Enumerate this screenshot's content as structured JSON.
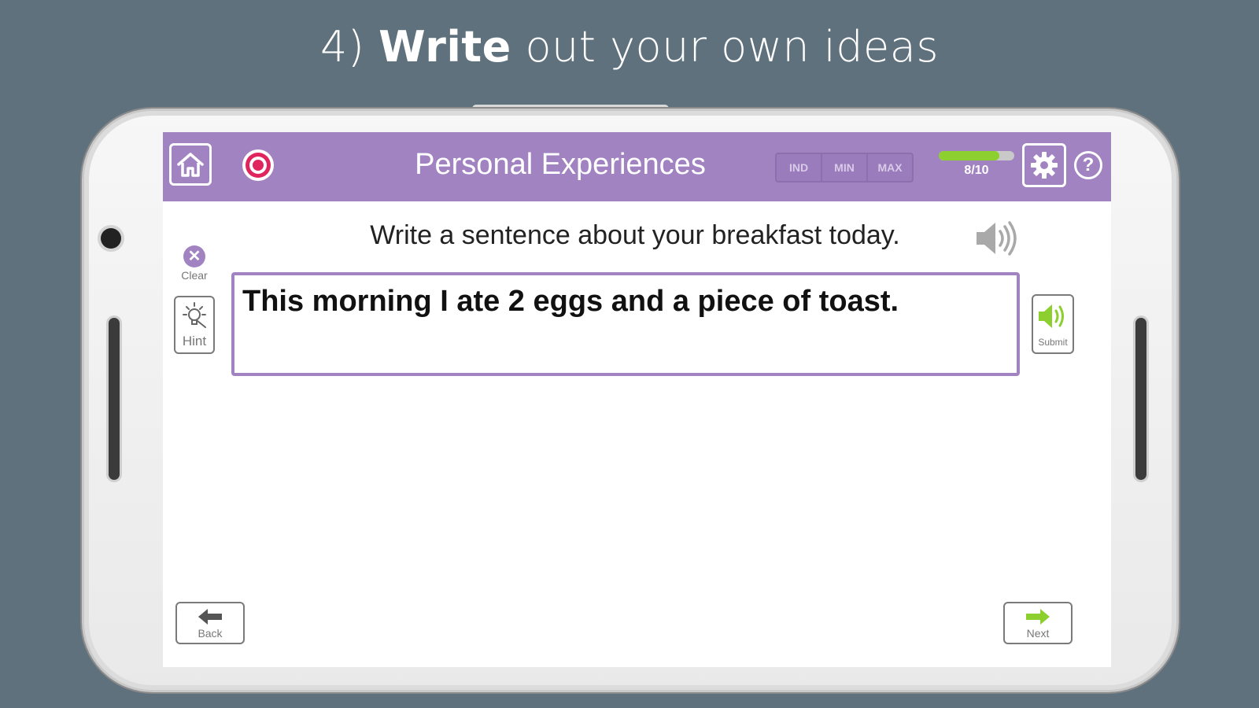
{
  "headline": {
    "number": "4)",
    "bold": "Write",
    "rest": "out your own ideas"
  },
  "app": {
    "title": "Personal Experiences",
    "modes": [
      "IND",
      "MIN",
      "MAX"
    ],
    "progress": {
      "text": "8/10",
      "current": 8,
      "total": 10
    },
    "help_label": "?"
  },
  "exercise": {
    "prompt": "Write a sentence about your breakfast today.",
    "answer": "This morning I ate 2 eggs and a piece of toast."
  },
  "buttons": {
    "clear": "Clear",
    "hint": "Hint",
    "submit": "Submit",
    "back": "Back",
    "next": "Next"
  },
  "icons": {
    "home": "home-icon",
    "record": "record-icon",
    "settings": "gear-icon",
    "help": "help-icon",
    "speaker": "speaker-icon",
    "clear": "clear-x-icon",
    "hint": "lightbulb-icon",
    "back": "arrow-left-icon",
    "next": "arrow-right-icon"
  },
  "colors": {
    "background": "#5f717d",
    "topbar": "#a283c2",
    "record": "#e0245e",
    "progress_fill": "#8ccf2e",
    "submit_accent": "#8ccf2e"
  }
}
